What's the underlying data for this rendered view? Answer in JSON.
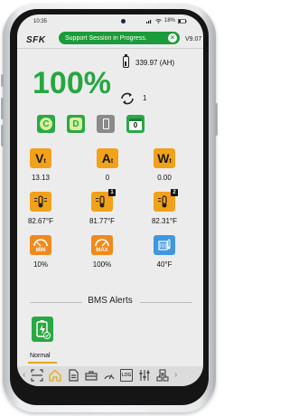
{
  "status_bar": {
    "time": "10:35",
    "battery": "18%"
  },
  "header": {
    "logo_text": "SFK",
    "toast_text": "Support Session in Progress.",
    "version": "V9.07"
  },
  "summary": {
    "state_of_charge": "100%",
    "capacity": "339.97 (AH)",
    "cycle_count": "1"
  },
  "status_icons": [
    {
      "name": "charge-indicator",
      "label": "C",
      "color": "#2ba847"
    },
    {
      "name": "discharge-indicator",
      "label": "D",
      "color": "#2ba847"
    },
    {
      "name": "battery-status",
      "label": "",
      "color": "#8a8a8a"
    },
    {
      "name": "calendar",
      "label": "0",
      "color": "#2ba847"
    }
  ],
  "metrics": [
    {
      "id": "voltage",
      "icon_letter": "V",
      "icon_sub": "t",
      "icon": "voltage-icon",
      "value": "13.13",
      "color": "#f2a11a"
    },
    {
      "id": "current",
      "icon_letter": "A",
      "icon_sub": "t",
      "icon": "current-icon",
      "value": "0",
      "color": "#f2a11a"
    },
    {
      "id": "power",
      "icon_letter": "W",
      "icon_sub": "t",
      "icon": "power-icon",
      "value": "0.00",
      "color": "#f2a11a"
    },
    {
      "id": "temp-internal",
      "icon": "thermometer-icon",
      "badge": "",
      "value": "82.67°F",
      "color": "#f2a11a"
    },
    {
      "id": "temp-sensor-1",
      "icon": "thermometer-icon",
      "badge": "1",
      "value": "81.77°F",
      "color": "#f2a11a"
    },
    {
      "id": "temp-sensor-2",
      "icon": "thermometer-icon",
      "badge": "2",
      "value": "82.31°F",
      "color": "#f2a11a"
    },
    {
      "id": "min-soc",
      "icon": "gauge-icon",
      "icon_text": "MIN",
      "value": "10%",
      "color": "#ef8a1e"
    },
    {
      "id": "max-soc",
      "icon": "gauge-icon",
      "icon_text": "MAX",
      "value": "100%",
      "color": "#ef8a1e"
    },
    {
      "id": "heater",
      "icon": "heater-icon",
      "value": "40°F",
      "color": "#3d97e3"
    }
  ],
  "alerts": {
    "title": "BMS Alerts",
    "items": [
      {
        "label": "Normal",
        "color": "#2aa843"
      }
    ]
  },
  "nav": {
    "items": [
      "scan-icon",
      "home-icon",
      "document-icon",
      "toolbox-icon",
      "gauge-icon",
      "log-icon",
      "sliders-icon",
      "network-icon"
    ],
    "active": "home-icon",
    "log_label": "LOG"
  }
}
